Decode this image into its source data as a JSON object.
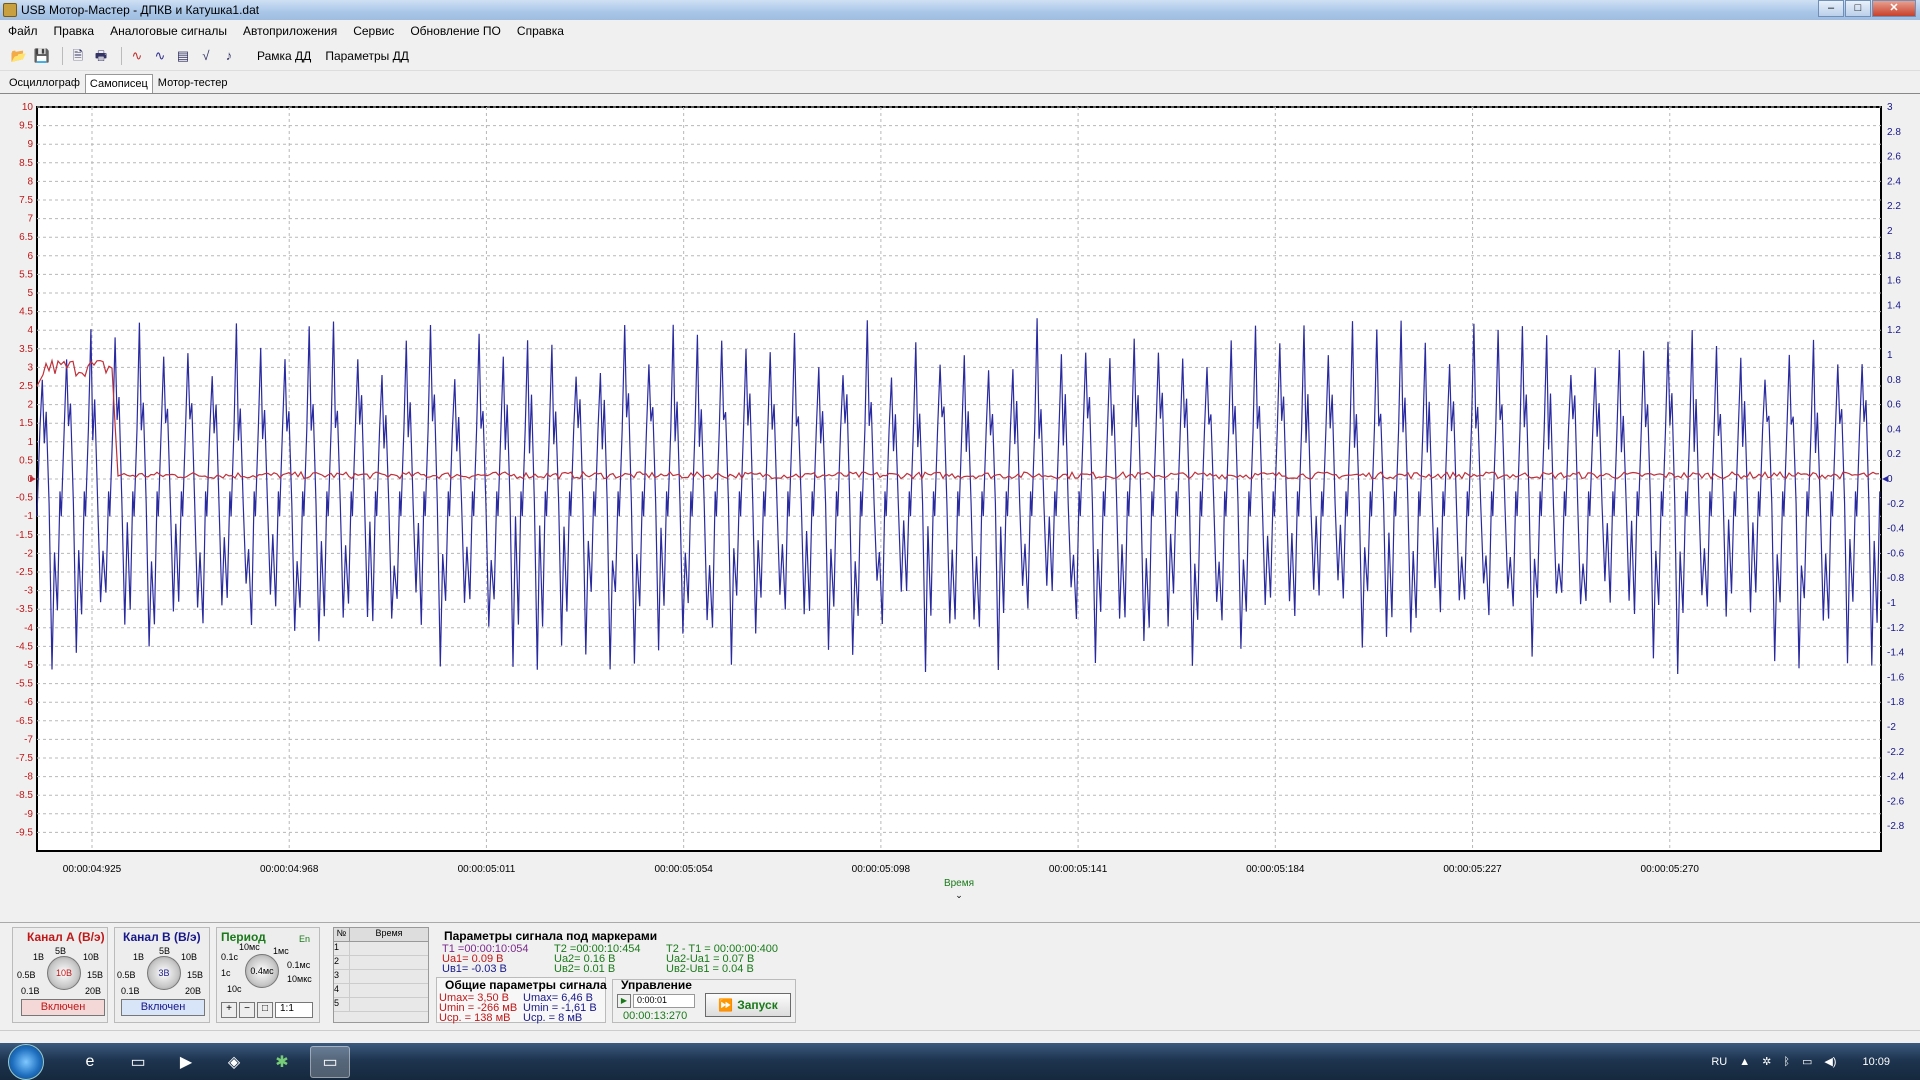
{
  "window": {
    "title": "USB Мотор-Мастер - ДПКВ и Катушка1.dat",
    "minimize": "–",
    "maximize": "□",
    "close": "✕"
  },
  "menu": [
    "Файл",
    "Правка",
    "Аналоговые сигналы",
    "Автоприложения",
    "Сервис",
    "Обновление ПО",
    "Справка"
  ],
  "toolbar": {
    "icons": [
      "open-icon",
      "save-icon",
      "preview-icon",
      "print-icon",
      "signal-a-icon",
      "signal-b-icon",
      "table-icon",
      "sqrt-icon",
      "audio-icon"
    ],
    "frame_label": "Рамка ДД",
    "params_label": "Параметры ДД"
  },
  "tabs": [
    {
      "label": "Осциллограф"
    },
    {
      "label": "Самописец",
      "active": true
    },
    {
      "label": "Мотор-тестер"
    }
  ],
  "chart_data": {
    "type": "line",
    "xlabel": "Время",
    "x_ticks": [
      "00:00:04:925",
      "00:00:04:968",
      "00:00:05:011",
      "00:00:05:054",
      "00:00:05:098",
      "00:00:05:141",
      "00:00:05:184",
      "00:00:05:227",
      "00:00:05:270"
    ],
    "left_axis": {
      "min": -10,
      "max": 10,
      "ticks": [
        "10",
        "9.5",
        "9",
        "8.5",
        "8",
        "7.5",
        "7",
        "6.5",
        "6",
        "5.5",
        "5",
        "4.5",
        "4",
        "3.5",
        "3",
        "2.5",
        "2",
        "1.5",
        "1",
        "0.5",
        "0",
        "-0.5",
        "-1",
        "-1.5",
        "-2",
        "-2.5",
        "-3",
        "-3.5",
        "-4",
        "-4.5",
        "-5",
        "-5.5",
        "-6",
        "-6.5",
        "-7",
        "-7.5",
        "-8",
        "-8.5",
        "-9",
        "-9.5"
      ]
    },
    "right_axis": {
      "min": -3,
      "max": 3,
      "ticks": [
        "3",
        "2.8",
        "2.6",
        "2.4",
        "2.2",
        "2",
        "1.8",
        "1.6",
        "1.4",
        "1.2",
        "1",
        "0.8",
        "0.6",
        "0.4",
        "0.2",
        "0",
        "-0.2",
        "-0.4",
        "-0.6",
        "-0.8",
        "-1",
        "-1.2",
        "-1.4",
        "-1.6",
        "-1.8",
        "-2",
        "-2.2",
        "-2.4",
        "-2.6",
        "-2.8"
      ]
    },
    "grid": true,
    "series": [
      {
        "channel": "A",
        "color": "#c0303a",
        "axis": "left",
        "high_level": 3.0,
        "low_level": 0.1,
        "step_time": "00:00:04:941"
      },
      {
        "channel": "B",
        "color": "#2a2aa0",
        "axis": "right",
        "pulses": 76,
        "max": 2.0,
        "min": -1.6
      }
    ],
    "x_scroll_position": 0.38
  },
  "panels": {
    "chA": {
      "title": "Канал А (В/э)",
      "value": "10В",
      "labels": [
        "5В",
        "10В",
        "15В",
        "20В",
        "1В",
        "0.5В",
        "0.1В"
      ],
      "button": "Включен",
      "color": "#c01818"
    },
    "chB": {
      "title": "Канал В (В/э)",
      "value": "3В",
      "labels": [
        "5В",
        "10В",
        "15В",
        "20В",
        "1В",
        "0.5В",
        "0.1В"
      ],
      "button": "Включен",
      "color": "#18188a"
    },
    "period": {
      "title": "Период",
      "value": "0.4мс",
      "labels": [
        "10мс",
        "1мс",
        "0.1мс",
        "10мкс",
        "0.1с",
        "1с",
        "10с"
      ],
      "en": "En",
      "zoom": "1:1",
      "color": "#1a7a1a"
    }
  },
  "marker_table": {
    "headers": [
      "№",
      "Время"
    ],
    "rows": [
      "1",
      "2",
      "3",
      "4",
      "5"
    ]
  },
  "marker_params": {
    "title": "Параметры сигнала под маркерами",
    "t1": "T1 =00:00:10:054",
    "ua1": "Uа1= 0.09 В",
    "ub1": "Uв1= -0.03 В",
    "t2": "T2 =00:00:10:454",
    "ua2": "Uа2= 0.16 В",
    "ub2": "Uв2= 0.01 В",
    "dt": "T2 - T1 = 00:00:00:400",
    "dua": "Uа2-Uа1 = 0.07 В",
    "dub": "Uв2-Uв1 = 0.04 В"
  },
  "general_params": {
    "title": "Общие параметры сигнала",
    "a_max": "Umax= 3,50 В",
    "a_min": "Umin = -266 мВ",
    "a_avg": "Uср. = 138 мВ",
    "b_max": "Umax= 6,46 В",
    "b_min": "Umin = -1,61 В",
    "b_avg": "Uср. = 8 мВ"
  },
  "control": {
    "title": "Управление",
    "time_value": "0:00:01",
    "elapsed": "00:00:13:270",
    "start_label": "Запуск"
  },
  "taskbar": {
    "lang": "RU",
    "time": "10:09"
  }
}
